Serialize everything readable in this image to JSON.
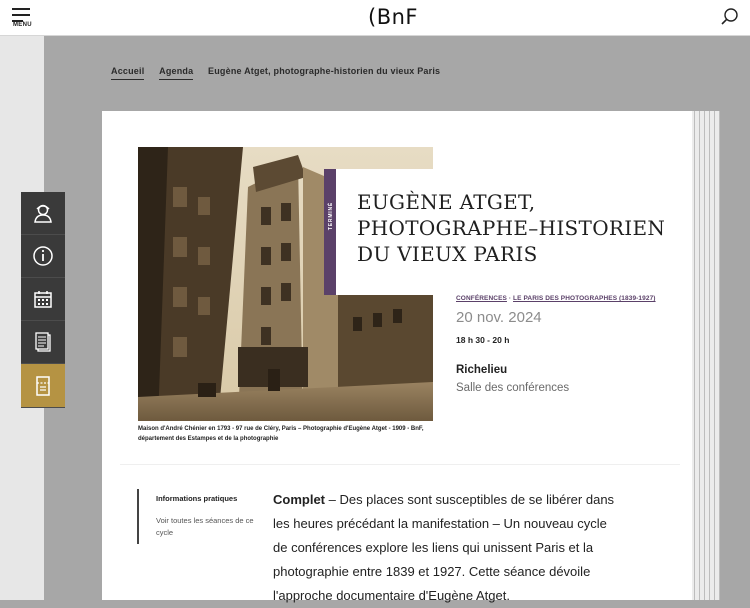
{
  "header": {
    "menu_label": "MENU",
    "logo_text": "(BnF",
    "menu_icon": "hamburger-icon",
    "search_icon": "search-icon"
  },
  "breadcrumb": {
    "items": [
      "Accueil",
      "Agenda",
      "Eugène Atget, photographe-historien du vieux Paris"
    ]
  },
  "side_tools": [
    {
      "icon": "visitor-icon"
    },
    {
      "icon": "info-icon"
    },
    {
      "icon": "calendar-icon"
    },
    {
      "icon": "document-icon"
    },
    {
      "icon": "ticket-icon"
    }
  ],
  "event": {
    "status_ribbon": "TERMINÉ",
    "title": "EUGÈNE ATGET, PHOTOGRAPHE–HISTORIEN DU VIEUX PARIS",
    "category": "CONFÉRENCES",
    "category_sep": " · ",
    "cycle": "LE PARIS DES PHOTOGRAPHES (1839-1927)",
    "date": "20 nov. 2024",
    "time": "18 h 30 - 20 h",
    "place": "Richelieu",
    "room": "Salle des conférences",
    "photo_caption": "Maison d'André Chénier en 1793 - 97 rue de Cléry, Paris – Photographie d'Eugène Atget - 1909 - BnF, département des Estampes et de la photographie"
  },
  "info_nav": {
    "active": "Informations pratiques",
    "link": "Voir toutes les séances de ce cycle"
  },
  "body": {
    "lead": "Complet",
    "text": " – Des places sont susceptibles de se libérer dans les heures précédant la manifestation – Un nouveau cycle de conférences explore les liens qui unissent Paris et la photographie entre 1839 et 1927. Cette séance dévoile l'approche documentaire d'Eugène Atget."
  },
  "colors": {
    "accent_purple": "#5b4169",
    "gold": "#b59343",
    "tool_dark": "#3a3a3a"
  }
}
